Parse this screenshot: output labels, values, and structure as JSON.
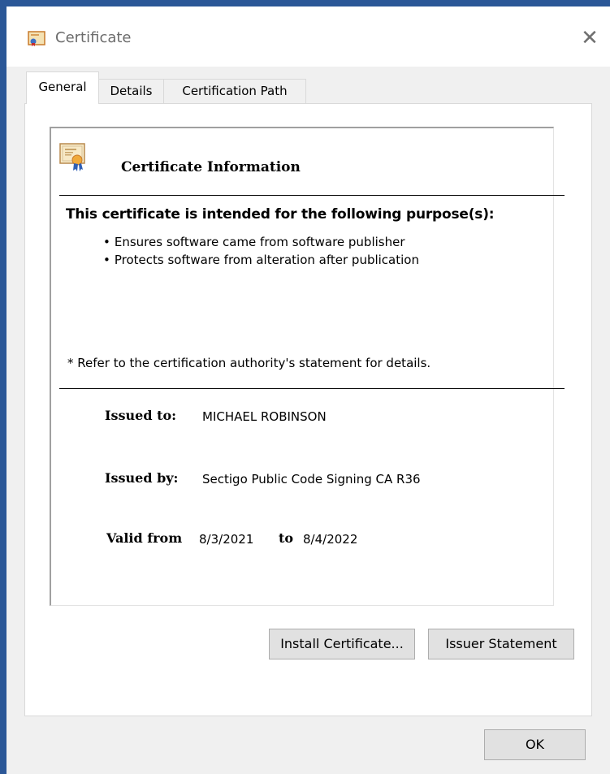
{
  "window": {
    "title": "Certificate",
    "close_glyph": "✕",
    "icon": "certificate-icon"
  },
  "tabs": [
    {
      "label": "General",
      "active": true
    },
    {
      "label": "Details",
      "active": false
    },
    {
      "label": "Certification Path",
      "active": false
    }
  ],
  "info": {
    "heading": "Certificate Information",
    "purpose_heading": "This certificate is intended for the following purpose(s):",
    "purposes": [
      "Ensures software came from software publisher",
      "Protects software from alteration after publication"
    ],
    "refer_note": "* Refer to the certification authority's statement for details.",
    "issued_to_label": "Issued to:",
    "issued_to": "MICHAEL ROBINSON",
    "issued_by_label": "Issued by:",
    "issued_by": "Sectigo Public Code Signing CA R36",
    "valid_from_label": "Valid from",
    "valid_from": "8/3/2021",
    "to_label": "to",
    "valid_to": "8/4/2022"
  },
  "buttons": {
    "install": "Install Certificate...",
    "issuer_statement": "Issuer Statement",
    "ok": "OK"
  },
  "colors": {
    "desktop": "#2b5797",
    "dialog": "#f0f0f0",
    "button": "#e1e1e1"
  }
}
